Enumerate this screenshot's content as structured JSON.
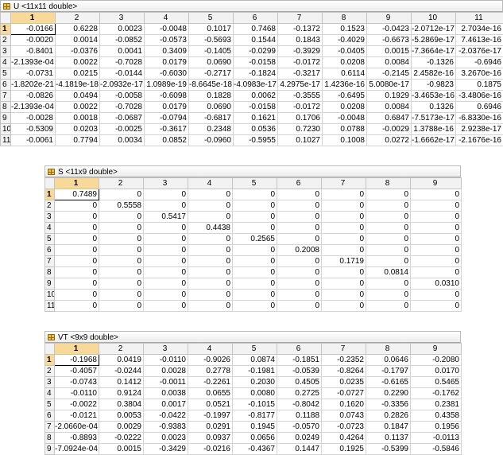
{
  "panels": [
    {
      "id": "u",
      "title": "U <11x11 double>",
      "active_col": "1",
      "cols": [
        "1",
        "2",
        "3",
        "4",
        "5",
        "6",
        "7",
        "8",
        "9",
        "10",
        "11"
      ],
      "rows": [
        {
          "label": "1",
          "values": [
            "-0.0166",
            "0.6228",
            "0.0023",
            "-0.0048",
            "0.1017",
            "0.7468",
            "-0.1372",
            "0.1523",
            "-0.0423",
            "-2.0712e-17",
            "2.7034e-16"
          ]
        },
        {
          "label": "2",
          "values": [
            "-0.0020",
            "0.0014",
            "-0.0852",
            "-0.0573",
            "-0.5693",
            "0.1544",
            "0.1843",
            "-0.4029",
            "-0.6673",
            "-5.2869e-17",
            "7.4613e-16"
          ]
        },
        {
          "label": "3",
          "values": [
            "-0.8401",
            "-0.0376",
            "0.0041",
            "0.3409",
            "-0.1405",
            "-0.0299",
            "-0.3929",
            "-0.0405",
            "0.0015",
            "-7.3664e-17",
            "-2.0376e-17"
          ]
        },
        {
          "label": "4",
          "values": [
            "-2.1393e-04",
            "0.0022",
            "-0.7028",
            "0.0179",
            "0.0690",
            "-0.0158",
            "-0.0172",
            "0.0208",
            "0.0084",
            "-0.1326",
            "-0.6946"
          ]
        },
        {
          "label": "5",
          "values": [
            "-0.0731",
            "0.0215",
            "-0.0144",
            "-0.6030",
            "-0.2717",
            "-0.1824",
            "-0.3217",
            "0.6114",
            "-0.2145",
            "2.4582e-16",
            "3.2670e-16"
          ]
        },
        {
          "label": "6",
          "values": [
            "-1.8202e-21",
            "-4.1819e-18",
            "-2.0932e-17",
            "1.0989e-19",
            "-8.6645e-18",
            "-4.0983e-17",
            "4.2975e-17",
            "1.4236e-16",
            "5.0080e-17",
            "-0.9823",
            "0.1875"
          ]
        },
        {
          "label": "7",
          "values": [
            "-0.0826",
            "0.0494",
            "-0.0058",
            "-0.6098",
            "0.1828",
            "0.0062",
            "-0.3555",
            "-0.6495",
            "0.1929",
            "-3.4653e-16",
            "-3.4806e-16"
          ]
        },
        {
          "label": "8",
          "values": [
            "-2.1393e-04",
            "0.0022",
            "-0.7028",
            "0.0179",
            "0.0690",
            "-0.0158",
            "-0.0172",
            "0.0208",
            "0.0084",
            "0.1326",
            "0.6946"
          ]
        },
        {
          "label": "9",
          "values": [
            "-0.0028",
            "0.0018",
            "-0.0687",
            "-0.0794",
            "-0.6817",
            "0.1621",
            "0.1706",
            "-0.0048",
            "0.6847",
            "-7.5173e-17",
            "-6.8330e-16"
          ]
        },
        {
          "label": "10",
          "values": [
            "-0.5309",
            "0.0203",
            "-0.0025",
            "-0.3617",
            "0.2348",
            "0.0536",
            "0.7230",
            "0.0788",
            "-0.0029",
            "1.3788e-16",
            "2.9238e-17"
          ]
        },
        {
          "label": "11",
          "values": [
            "-0.0061",
            "0.7794",
            "0.0034",
            "0.0852",
            "-0.0960",
            "-0.5955",
            "0.1027",
            "0.1008",
            "0.0272",
            "-1.6662e-17",
            "-2.1676e-16"
          ]
        }
      ]
    },
    {
      "id": "s",
      "title": "S <11x9 double>",
      "active_col": "1",
      "cols": [
        "1",
        "2",
        "3",
        "4",
        "5",
        "6",
        "7",
        "8",
        "9"
      ],
      "rows": [
        {
          "label": "1",
          "values": [
            "0.7489",
            "0",
            "0",
            "0",
            "0",
            "0",
            "0",
            "0",
            "0"
          ]
        },
        {
          "label": "2",
          "values": [
            "0",
            "0.5558",
            "0",
            "0",
            "0",
            "0",
            "0",
            "0",
            "0"
          ]
        },
        {
          "label": "3",
          "values": [
            "0",
            "0",
            "0.5417",
            "0",
            "0",
            "0",
            "0",
            "0",
            "0"
          ]
        },
        {
          "label": "4",
          "values": [
            "0",
            "0",
            "0",
            "0.4438",
            "0",
            "0",
            "0",
            "0",
            "0"
          ]
        },
        {
          "label": "5",
          "values": [
            "0",
            "0",
            "0",
            "0",
            "0.2565",
            "0",
            "0",
            "0",
            "0"
          ]
        },
        {
          "label": "6",
          "values": [
            "0",
            "0",
            "0",
            "0",
            "0",
            "0.2008",
            "0",
            "0",
            "0"
          ]
        },
        {
          "label": "7",
          "values": [
            "0",
            "0",
            "0",
            "0",
            "0",
            "0",
            "0.1719",
            "0",
            "0"
          ]
        },
        {
          "label": "8",
          "values": [
            "0",
            "0",
            "0",
            "0",
            "0",
            "0",
            "0",
            "0.0814",
            "0"
          ]
        },
        {
          "label": "9",
          "values": [
            "0",
            "0",
            "0",
            "0",
            "0",
            "0",
            "0",
            "0",
            "0.0310"
          ]
        },
        {
          "label": "10",
          "values": [
            "0",
            "0",
            "0",
            "0",
            "0",
            "0",
            "0",
            "0",
            "0"
          ]
        },
        {
          "label": "11",
          "values": [
            "0",
            "0",
            "0",
            "0",
            "0",
            "0",
            "0",
            "0",
            "0"
          ]
        }
      ]
    },
    {
      "id": "vt",
      "title": "VT <9x9 double>",
      "active_col": "1",
      "cols": [
        "1",
        "2",
        "3",
        "4",
        "5",
        "6",
        "7",
        "8",
        "9"
      ],
      "rows": [
        {
          "label": "1",
          "values": [
            "-0.1968",
            "0.0419",
            "-0.0110",
            "-0.9026",
            "0.0874",
            "-0.1851",
            "-0.2352",
            "0.0646",
            "-0.2080"
          ]
        },
        {
          "label": "2",
          "values": [
            "-0.4057",
            "-0.0244",
            "0.0028",
            "0.2778",
            "-0.1981",
            "-0.0539",
            "-0.8264",
            "-0.1797",
            "0.0170"
          ]
        },
        {
          "label": "3",
          "values": [
            "-0.0743",
            "0.1412",
            "-0.0011",
            "-0.2261",
            "0.2030",
            "0.4505",
            "0.0235",
            "-0.6165",
            "0.5465"
          ]
        },
        {
          "label": "4",
          "values": [
            "-0.0110",
            "0.9124",
            "0.0038",
            "0.0655",
            "0.0080",
            "0.2725",
            "-0.0727",
            "0.2290",
            "-0.1762"
          ]
        },
        {
          "label": "5",
          "values": [
            "-0.0022",
            "0.3804",
            "0.0017",
            "0.0521",
            "-0.1015",
            "-0.8042",
            "0.1620",
            "-0.3356",
            "0.2381"
          ]
        },
        {
          "label": "6",
          "values": [
            "-0.0121",
            "0.0053",
            "-0.0422",
            "-0.1997",
            "-0.8177",
            "0.1188",
            "0.0743",
            "0.2826",
            "0.4358"
          ]
        },
        {
          "label": "7",
          "values": [
            "-2.0660e-04",
            "0.0029",
            "-0.9383",
            "0.0291",
            "0.1945",
            "-0.0570",
            "-0.0723",
            "0.1847",
            "0.1956"
          ]
        },
        {
          "label": "8",
          "values": [
            "-0.8893",
            "-0.0222",
            "0.0023",
            "0.0937",
            "0.0656",
            "0.0249",
            "0.4264",
            "0.1137",
            "-0.0113"
          ]
        },
        {
          "label": "9",
          "values": [
            "-7.0924e-04",
            "0.0015",
            "-0.3429",
            "-0.0216",
            "-0.4367",
            "0.1447",
            "0.1925",
            "-0.5399",
            "-0.5846"
          ]
        }
      ]
    }
  ]
}
